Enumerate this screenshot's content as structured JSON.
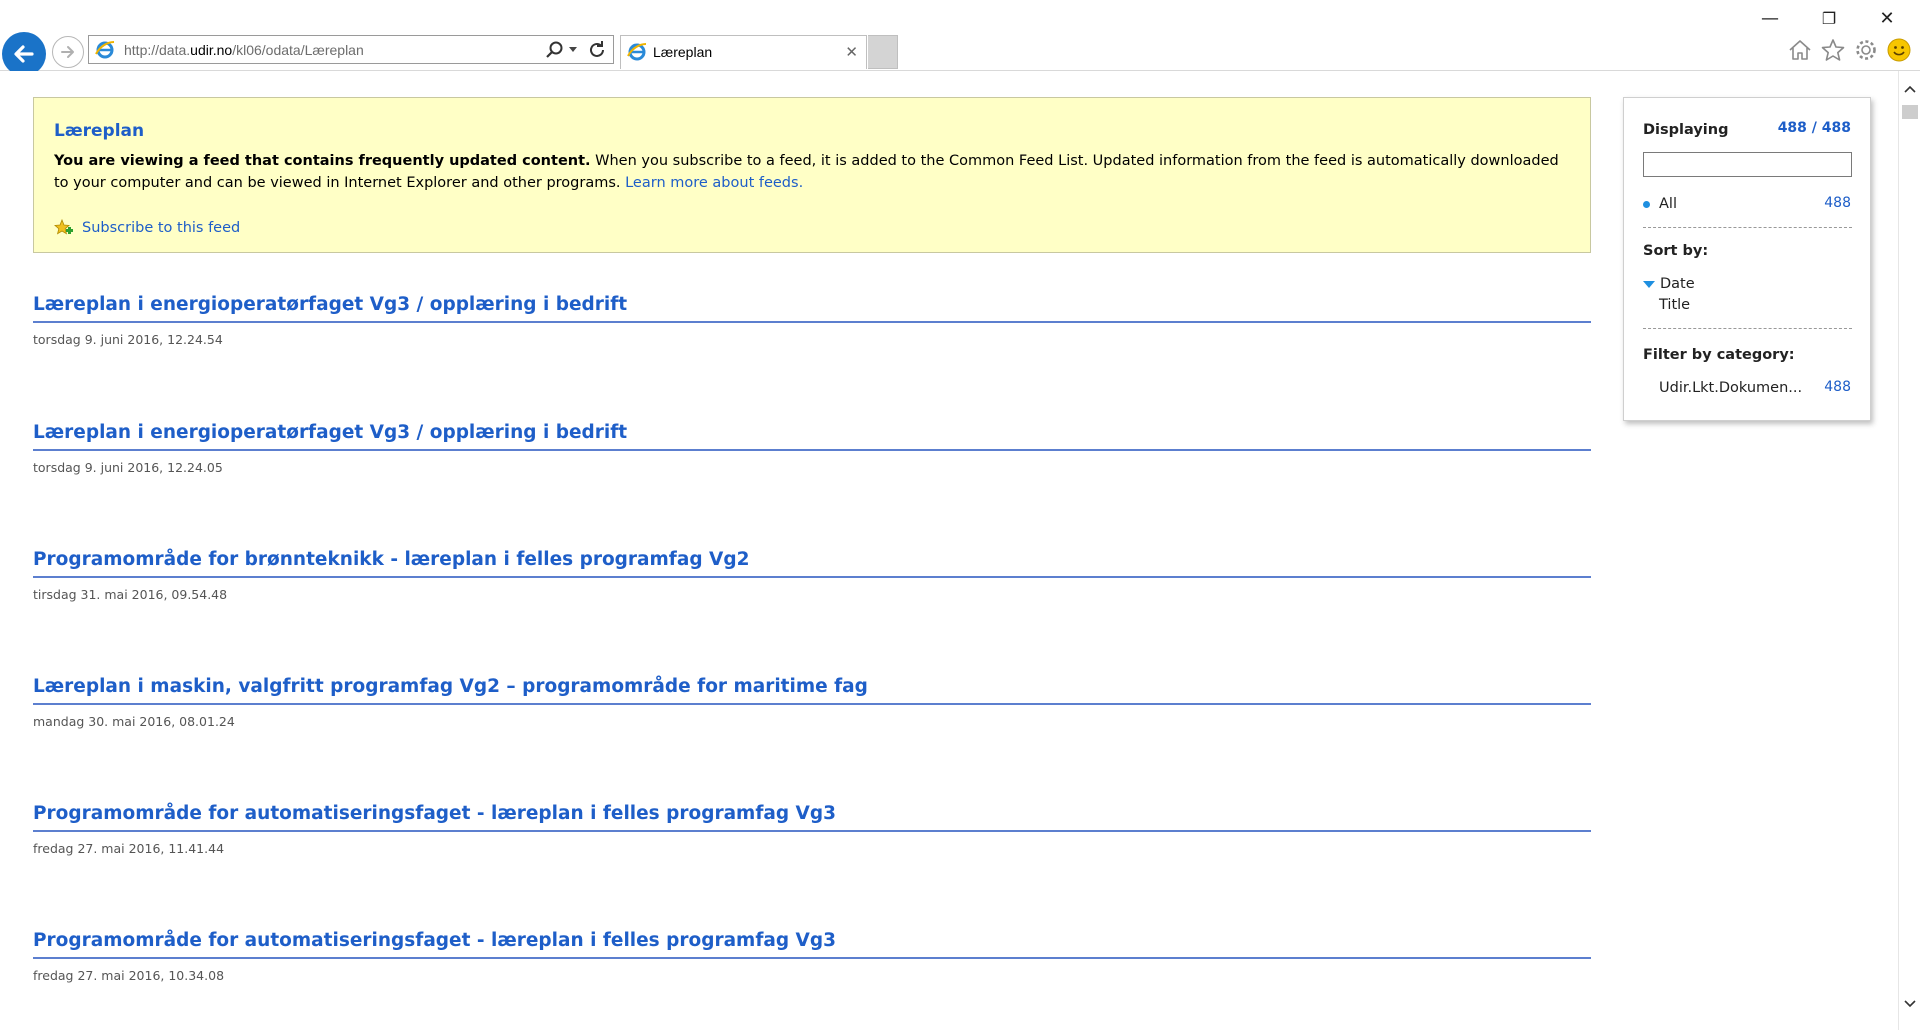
{
  "browser": {
    "url_prefix": "http://data.",
    "url_domain": "udir.no",
    "url_path": "/kl06/odata/Læreplan",
    "tab_title": "Læreplan",
    "tab_close": "✕"
  },
  "window_controls": {
    "minimize": "—",
    "restore": "❐",
    "close": "✕"
  },
  "banner": {
    "title": "Læreplan",
    "bold_text": "You are viewing a feed that contains frequently updated content.",
    "text": " When you subscribe to a feed, it is added to the Common Feed List. Updated information from the feed is automatically downloaded to your computer and can be viewed in Internet Explorer and other programs. ",
    "learn_more": "Learn more about feeds.",
    "subscribe_label": "Subscribe to this feed"
  },
  "feed_items": [
    {
      "title": "Læreplan i energioperatørfaget Vg3 / opplæring i bedrift",
      "date": "torsdag 9. juni 2016, 12.24.54"
    },
    {
      "title": "Læreplan i energioperatørfaget Vg3 / opplæring i bedrift",
      "date": "torsdag 9. juni 2016, 12.24.05"
    },
    {
      "title": "Programområde for brønnteknikk - læreplan i felles programfag Vg2",
      "date": "tirsdag 31. mai 2016, 09.54.48"
    },
    {
      "title": "Læreplan i maskin, valgfritt programfag Vg2 – programområde for maritime fag",
      "date": "mandag 30. mai 2016, 08.01.24"
    },
    {
      "title": "Programområde for automatiseringsfaget - læreplan i felles programfag Vg3",
      "date": "fredag 27. mai 2016, 11.41.44"
    },
    {
      "title": "Programområde for automatiseringsfaget - læreplan i felles programfag Vg3",
      "date": "fredag 27. mai 2016, 10.34.08"
    }
  ],
  "panel": {
    "displaying_label": "Displaying",
    "displaying_count": "488 / 488",
    "search_value": "",
    "all_label": "All",
    "all_count": "488",
    "sort_label": "Sort by:",
    "sort_date": "Date",
    "sort_title": "Title",
    "filter_label": "Filter by category:",
    "category_label": "Udir.Lkt.Dokumen...",
    "category_count": "488"
  },
  "colors": {
    "accent": "#1e5ec8",
    "banner_bg": "#ffffc6",
    "back_button": "#1a73c8"
  }
}
